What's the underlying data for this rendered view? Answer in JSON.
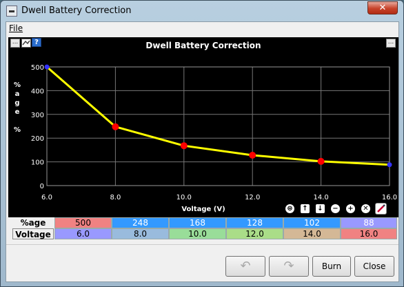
{
  "window": {
    "title": "Dwell Battery Correction",
    "close_symbol": "✕"
  },
  "menu": {
    "file": "File"
  },
  "chart_toolbar": {
    "options_left": "...",
    "help": "?",
    "options_right": "..."
  },
  "chart_data": {
    "type": "line",
    "title": "Dwell Battery Correction",
    "xlabel": "Voltage (V)",
    "ylabel": "%age %",
    "x": [
      6.0,
      8.0,
      10.0,
      12.0,
      14.0,
      16.0
    ],
    "series": [
      {
        "values": [
          500,
          248,
          168,
          128,
          102,
          88
        ]
      }
    ],
    "xlim": [
      6.0,
      16.0
    ],
    "ylim": [
      0,
      500
    ],
    "xticks": [
      "6.0",
      "8.0",
      "10.0",
      "12.0",
      "14.0",
      "16.0"
    ],
    "yticks": [
      "0",
      "100",
      "200",
      "300",
      "400",
      "500"
    ],
    "line_color": "#ffff00",
    "point_color": "#ff0000",
    "endpoint_color": "#3333ff",
    "grid": true
  },
  "table_tools": [
    "⊜",
    "↑",
    "↓",
    "−",
    "+",
    "✕",
    "/"
  ],
  "table": {
    "row1_label": "%age",
    "row2_label": "Voltage",
    "row1": [
      {
        "v": "500",
        "bg": "#f08282",
        "fg": "#000000"
      },
      {
        "v": "248",
        "bg": "#3399ff",
        "fg": "#ffffff"
      },
      {
        "v": "168",
        "bg": "#3399ff",
        "fg": "#ffffff"
      },
      {
        "v": "128",
        "bg": "#3399ff",
        "fg": "#ffffff"
      },
      {
        "v": "102",
        "bg": "#3399ff",
        "fg": "#ffffff"
      },
      {
        "v": "88",
        "bg": "#9999ff",
        "fg": "#ffffff"
      }
    ],
    "row2": [
      {
        "v": "6.0",
        "bg": "#9999ff",
        "fg": "#000000"
      },
      {
        "v": "8.0",
        "bg": "#99bbdd",
        "fg": "#000000"
      },
      {
        "v": "10.0",
        "bg": "#99dd99",
        "fg": "#000000"
      },
      {
        "v": "12.0",
        "bg": "#aadd88",
        "fg": "#000000"
      },
      {
        "v": "14.0",
        "bg": "#d4b896",
        "fg": "#000000"
      },
      {
        "v": "16.0",
        "bg": "#f08282",
        "fg": "#000000"
      }
    ]
  },
  "buttons": {
    "undo": "↶",
    "redo": "↷",
    "burn": "Burn",
    "close": "Close"
  }
}
